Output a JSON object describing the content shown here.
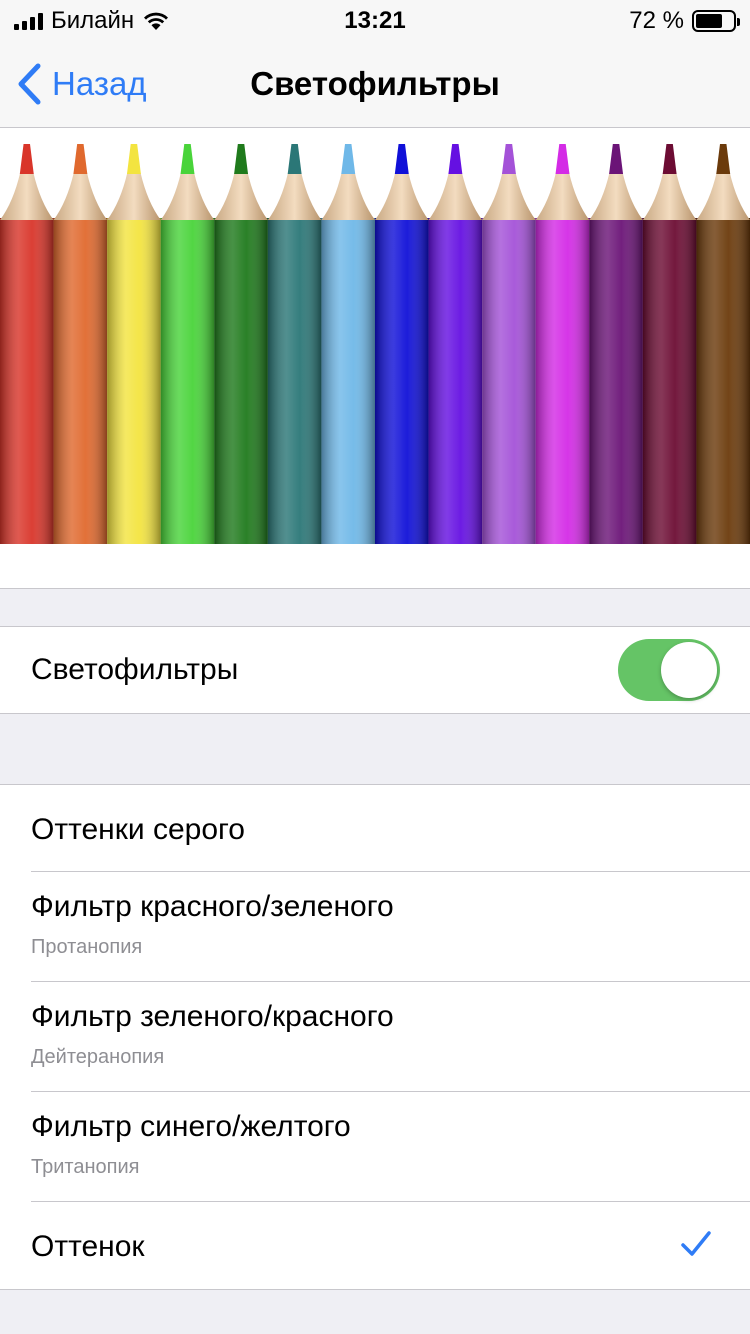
{
  "status_bar": {
    "carrier": "Билайн",
    "time": "13:21",
    "battery_percent": "72 %",
    "battery_level": 0.72,
    "signal_icon": "cellular-signal-icon",
    "wifi_icon": "wifi-icon"
  },
  "nav": {
    "back_label": "Назад",
    "back_icon": "chevron-left-icon",
    "title": "Светофильтры"
  },
  "banner": {
    "image": "colored-pencils-illustration",
    "pencil_colors": [
      "#d9352a",
      "#e0692e",
      "#f3e440",
      "#49d43a",
      "#1f7a1c",
      "#2b7777",
      "#6fb8e8",
      "#1010d8",
      "#6510e2",
      "#a452d8",
      "#d42be6",
      "#6b1477",
      "#6c0c33",
      "#6b3a0b"
    ]
  },
  "toggle_row": {
    "label": "Светофильтры",
    "enabled": true
  },
  "filters": [
    {
      "title": "Оттенки серого",
      "subtitle": "",
      "selected": false
    },
    {
      "title": "Фильтр красного/зеленого",
      "subtitle": "Протанопия",
      "selected": false
    },
    {
      "title": "Фильтр зеленого/красного",
      "subtitle": "Дейтеранопия",
      "selected": false
    },
    {
      "title": "Фильтр синего/желтого",
      "subtitle": "Тританопия",
      "selected": false
    },
    {
      "title": "Оттенок",
      "subtitle": "",
      "selected": true
    }
  ],
  "colors": {
    "accent": "#2f7cf6",
    "toggle_on": "#65c466",
    "background": "#efeff4"
  }
}
